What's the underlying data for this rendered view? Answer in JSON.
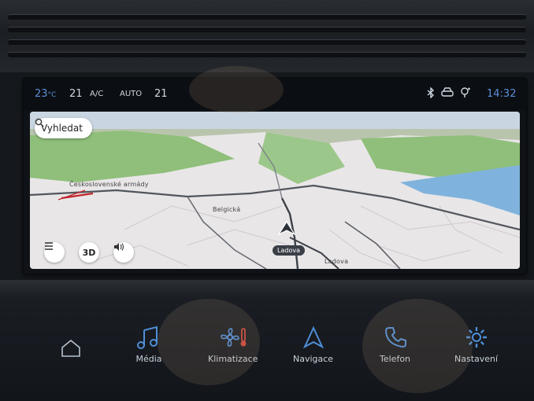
{
  "status_bar": {
    "temp_left": "23",
    "temp_left_unit": "°C",
    "fan": "21",
    "ac_label": "A/C",
    "auto_label": "AUTO",
    "temp_right": "21",
    "time": "14:32",
    "icons": [
      "bluetooth-icon",
      "car-connect-icon",
      "location-icon"
    ]
  },
  "map": {
    "search_label": "Vyhledat",
    "roads": [
      "Československé armády",
      "Belgická",
      "Ladova"
    ],
    "current_street": "Ladova",
    "btn_menu": "menu-icon",
    "btn_3d": "3D",
    "btn_sound": "speaker-icon",
    "colors": {
      "land": "#e9e6e8",
      "green": "#8fbf7a",
      "water": "#7fb3dd",
      "sky": "#c9d6e2",
      "route": "#c0262b"
    }
  },
  "dock": {
    "home_icon": "home-icon",
    "items": [
      {
        "label": "Média",
        "icon": "music-icon"
      },
      {
        "label": "Klimatizace",
        "icon": "fan-thermometer-icon"
      },
      {
        "label": "Navigace",
        "icon": "navigation-arrow-icon"
      },
      {
        "label": "Telefon",
        "icon": "phone-icon"
      },
      {
        "label": "Nastavení",
        "icon": "gear-icon"
      }
    ],
    "accent": "#4f8ed8"
  }
}
